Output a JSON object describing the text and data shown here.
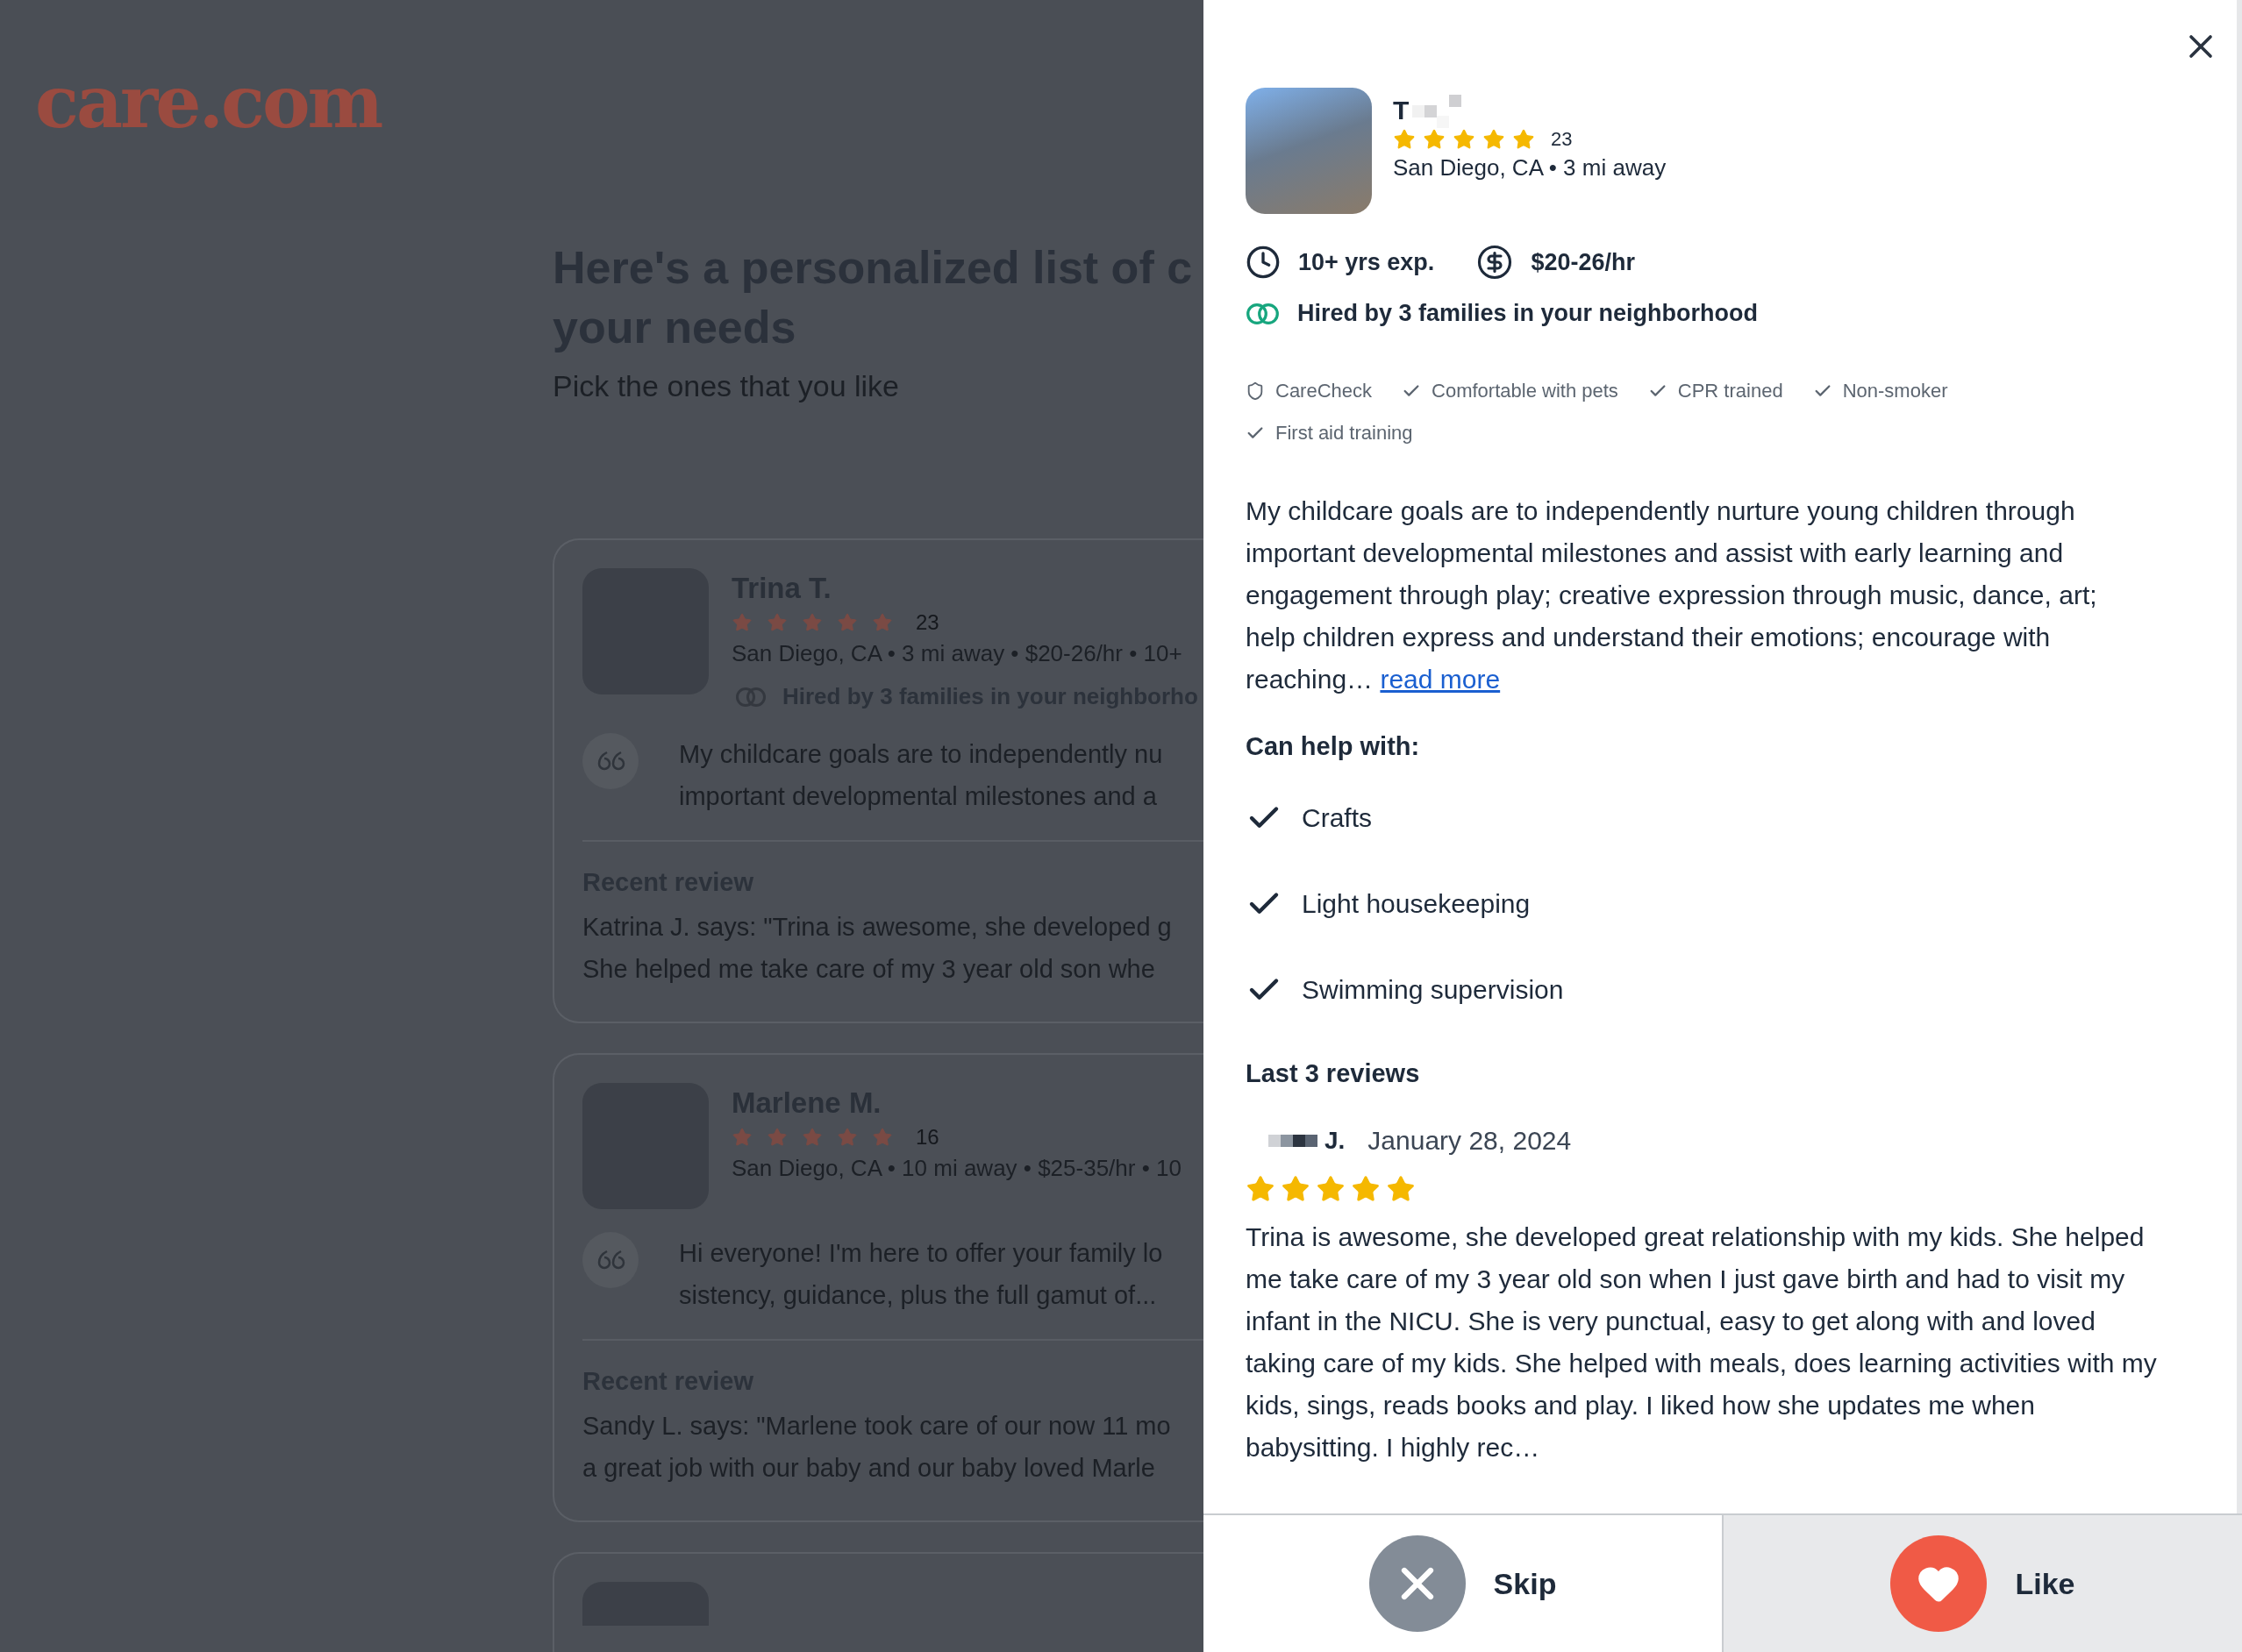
{
  "logo": "care.com",
  "intro": {
    "heading_lines": [
      "Here's a personalized list of c",
      "your needs"
    ],
    "subtitle": "Pick the ones that you like"
  },
  "cards": [
    {
      "name": "Trina T.",
      "stars": 5,
      "review_count": "23",
      "meta": "San Diego, CA • 3 mi away • $20-26/hr • 10+",
      "hired": "Hired by 3 families in your neighborho",
      "quote_lines": [
        "My childcare goals are to independently nu",
        "important developmental milestones and a"
      ],
      "review_title": "Recent review",
      "review_lines": [
        "Katrina J. says: \"Trina is awesome, she developed g",
        "She helped me take care of my 3 year old son whe"
      ]
    },
    {
      "name": "Marlene M.",
      "stars": 5,
      "review_count": "16",
      "meta": "San Diego, CA • 10 mi away • $25-35/hr • 10",
      "quote_lines": [
        "Hi everyone! I'm here to offer your family lo",
        "sistency, guidance, plus the full gamut of..."
      ],
      "review_title": "Recent review",
      "review_lines": [
        "Sandy L. says: \"Marlene took care of our now 11 mo",
        "a great job with our baby and our baby loved Marle"
      ]
    }
  ],
  "more_cards_below": true,
  "profile": {
    "name": "T",
    "name_obscured": true,
    "stars": 5,
    "review_count": "23",
    "location": "San Diego, CA • 3 mi away",
    "experience": "10+ yrs exp.",
    "rate": "$20-26/hr",
    "hired": "Hired by 3 families in your neighborhood",
    "badges": [
      {
        "kind": "shield",
        "label": "CareCheck"
      },
      {
        "kind": "check",
        "label": "Comfortable with pets"
      },
      {
        "kind": "check",
        "label": "CPR trained"
      },
      {
        "kind": "check",
        "label": "Non-smoker"
      },
      {
        "kind": "check",
        "label": "First aid training"
      }
    ],
    "bio": "My childcare goals are to independently nurture young children through important developmental milestones and assist with early learning and engagement through play; creative expression through music, dance, art; help children express and understand their emotions; encourage with reaching…",
    "read_more": "read more",
    "help_title": "Can help with:",
    "help_items": [
      "Crafts",
      "Light housekeeping",
      "Swimming supervision"
    ],
    "reviews_title": "Last 3 reviews",
    "reviews": [
      {
        "author": "J.",
        "author_obscured": true,
        "date": "January 28, 2024",
        "stars": 5,
        "text": "Trina is awesome, she developed great relationship with my kids. She helped me take care of my 3 year old son when I just gave birth and had to visit my infant in the NICU. She is very punctual, easy to get along with and loved taking care of my kids. She helped with meals, does learning activities with my kids, sings, reads books and play. I liked how she updates me when babysitting. I highly rec…"
      }
    ]
  },
  "actions": [
    {
      "kind": "skip",
      "label": "Skip"
    },
    {
      "kind": "like",
      "label": "Like"
    }
  ]
}
